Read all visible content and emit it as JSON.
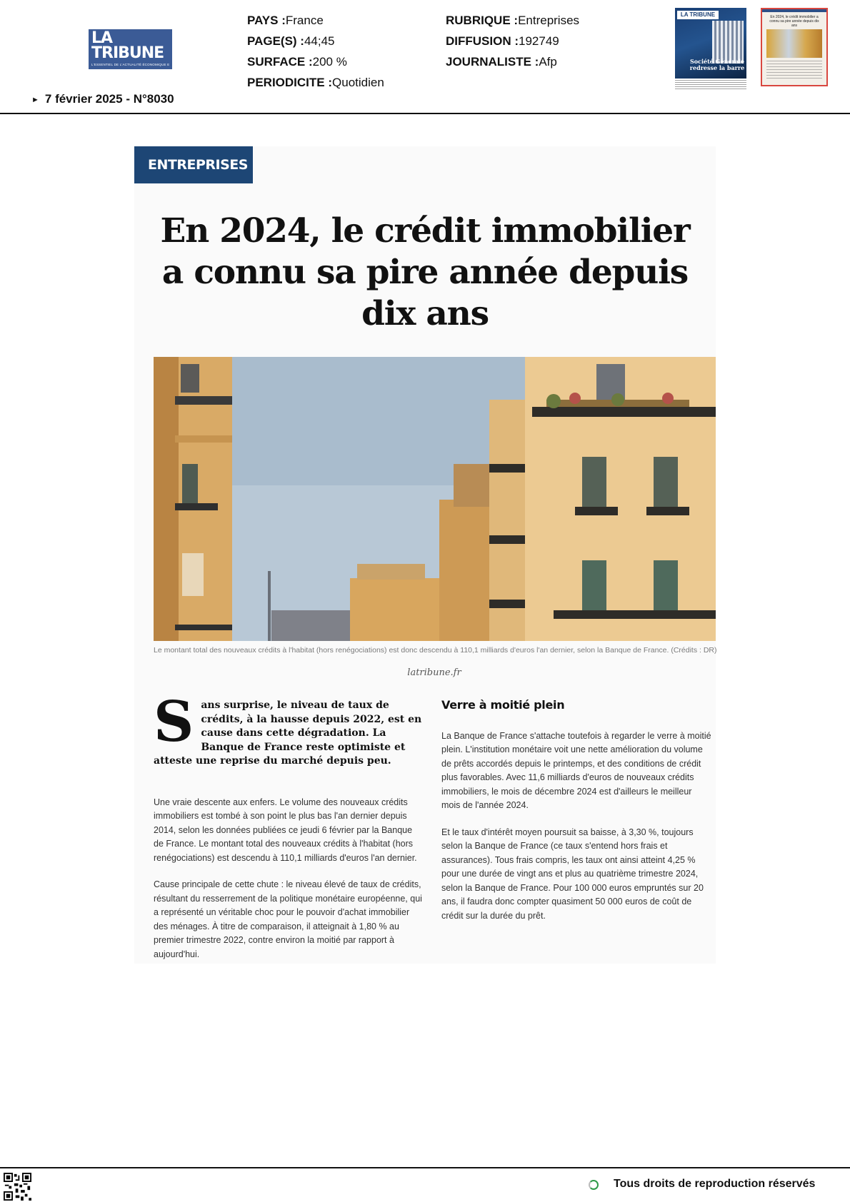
{
  "header": {
    "logo_line1": "LA",
    "logo_line2": "TRIBUNE",
    "logo_tagline": "L'ESSENTIEL DE L'ACTUALITÉ ÉCONOMIQUE ET FINANCIÈRE",
    "date_issue": "7 février 2025 - N°8030",
    "meta_left": [
      {
        "label": "PAYS :",
        "value": "France"
      },
      {
        "label": "PAGE(S) :",
        "value": "44;45"
      },
      {
        "label": "SURFACE :",
        "value": "200 %"
      },
      {
        "label": "PERIODICITE :",
        "value": "Quotidien"
      }
    ],
    "meta_right": [
      {
        "label": "RUBRIQUE :",
        "value": "Entreprises"
      },
      {
        "label": "DIFFUSION :",
        "value": "192749"
      },
      {
        "label": "JOURNALISTE :",
        "value": "Afp"
      }
    ],
    "thumbnail_cover": {
      "logo": "LA TRIBUNE",
      "headline": "Société Générale redresse la barre"
    },
    "thumbnail_page": {
      "headline": "En 2024, le crédit immobilier a connu sa pire année depuis dix ans"
    }
  },
  "article": {
    "rubrique": "ENTREPRISES",
    "headline": "En 2024, le crédit immobilier a connu sa pire année depuis dix ans",
    "photo_alt": "Immeubles haussmanniens à Paris",
    "caption": "Le montant total des nouveaux crédits à l'habitat (hors renégociations) est donc descendu à 110,1 milliards d'euros l'an dernier, selon la Banque de France. (Crédits : DR)",
    "source": "latribune.fr",
    "dropcap": "S",
    "lead": "ans surprise, le niveau de taux de crédits, à la hausse depuis 2022, est en cause dans cette dégradation. La Banque de France reste optimiste et atteste une reprise du marché depuis peu.",
    "left_paragraphs": [
      "Une vraie descente aux enfers. Le volume des nouveaux crédits immobiliers est tombé à son point le plus bas l'an dernier depuis 2014, selon les données publiées ce jeudi 6 février par la Banque de France. Le montant total des nouveaux crédits à l'habitat (hors renégociations) est descendu à 110,1 milliards d'euros l'an dernier.",
      "Cause principale de cette chute : le niveau élevé de taux de crédits, résultant du resserrement de la politique monétaire européenne, qui a représenté un véritable choc pour le pouvoir d'achat immobilier des ménages. À titre de comparaison, il atteignait à 1,80 % au premier trimestre 2022, contre environ la moitié par rapport à aujourd'hui."
    ],
    "right_subhead": "Verre à moitié plein",
    "right_paragraphs": [
      "La Banque de France s'attache toutefois à regarder le verre à moitié plein. L'institution monétaire voit une nette amélioration du volume de prêts accordés depuis le printemps, et des conditions de crédit plus favorables. Avec 11,6 milliards d'euros de nouveaux crédits immobiliers, le mois de décembre 2024 est d'ailleurs le meilleur mois de l'année 2024.",
      "Et le taux d'intérêt moyen poursuit sa baisse, à 3,30 %, toujours selon la Banque de France (ce taux s'entend hors frais et assurances). Tous frais compris, les taux ont ainsi atteint 4,25 % pour une durée de vingt ans et plus au quatrième trimestre 2024, selon la Banque de France. Pour 100 000 euros empruntés sur 20 ans, il faudra donc compter quasiment 50 000 euros de coût de crédit sur la durée du prêt."
    ]
  },
  "footer": {
    "rights": "Tous droits de reproduction réservés"
  },
  "colors": {
    "brand_blue": "#1d4675",
    "logo_blue": "#3b5b96",
    "accent_green": "#2e9a48",
    "thumbnail_border": "#d9473f"
  },
  "icons": [
    "arrow-right-icon",
    "qr-code-icon",
    "status-ring-icon"
  ]
}
